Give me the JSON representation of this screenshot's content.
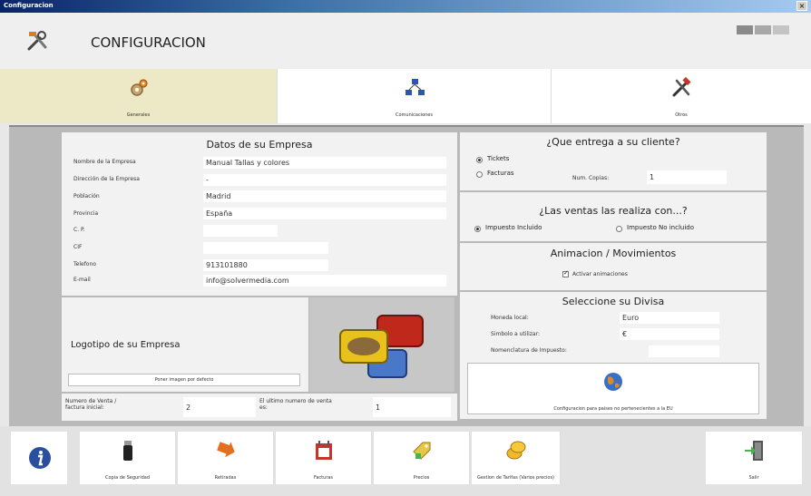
{
  "window": {
    "title": "Configuracion",
    "close": "×"
  },
  "header": {
    "title": "CONFIGURACION"
  },
  "tabs": [
    {
      "label": "Generales"
    },
    {
      "label": "Comunicaciones"
    },
    {
      "label": "Otros"
    }
  ],
  "company": {
    "title": "Datos de su Empresa",
    "fields": [
      {
        "label": "Nombre de la Empresa",
        "value": "Manual Tallas y colores"
      },
      {
        "label": "Dirección de la Empresa",
        "value": "-"
      },
      {
        "label": "Población",
        "value": "Madrid"
      },
      {
        "label": "Provincia",
        "value": "España"
      },
      {
        "label": "C. P.",
        "value": ""
      },
      {
        "label": "CIF",
        "value": ""
      },
      {
        "label": "Telefono",
        "value": "913101880"
      },
      {
        "label": "E-mail",
        "value": "info@solvermedia.com"
      }
    ]
  },
  "logo": {
    "title": "Logotipo de su Empresa",
    "default_button": "Poner imagen por defecto"
  },
  "numbers": {
    "initial_label": "Numero de Venta / factura inicial:",
    "initial_value": "2",
    "last_label": "El ultimo numero de venta es:",
    "last_value": "1"
  },
  "delivery": {
    "title": "¿Que entrega a su cliente?",
    "option_tickets": "Tickets",
    "option_facturas": "Facturas",
    "copies_label": "Num. Copias:",
    "copies_value": "1"
  },
  "tax": {
    "title": "¿Las ventas las realiza con...?",
    "option_included": "Impuesto Incluido",
    "option_not_included": "Impuesto No incluido"
  },
  "animation": {
    "title": "Animacion / Movimientos",
    "checkbox_label": "Activar animaciones"
  },
  "currency": {
    "title": "Seleccione su Divisa",
    "local_label": "Moneda local:",
    "local_value": "Euro",
    "symbol_label": "Simbolo a utilizar:",
    "symbol_value": "€",
    "tax_label": "Nomenclatura de Impuesto:",
    "tax_value": "",
    "non_eu_button": "Configuracion para paises no pertenecientes a la EU"
  },
  "toolbar": {
    "items": [
      {
        "label": "Copia de Seguridad"
      },
      {
        "label": "Retiradas"
      },
      {
        "label": "Facturas"
      },
      {
        "label": "Precios"
      },
      {
        "label": "Gestion de Tarifas (Varios precios)"
      }
    ],
    "exit": "Salir"
  }
}
